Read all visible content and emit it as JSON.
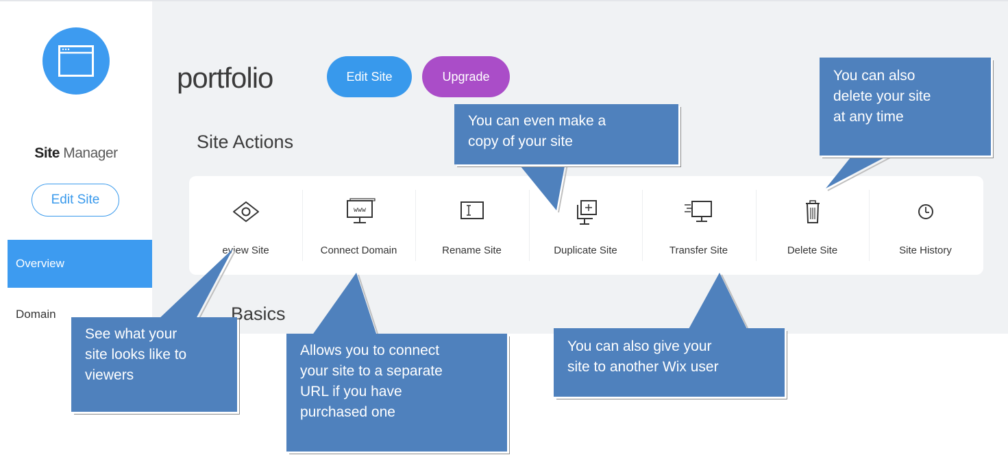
{
  "sidebar": {
    "title_bold": "Site",
    "title_rest": " Manager",
    "edit_button": "Edit Site",
    "items": [
      {
        "label": "Overview",
        "active": true
      },
      {
        "label": "Domain"
      }
    ]
  },
  "header": {
    "site_name": "portfolio",
    "edit_button": "Edit Site",
    "upgrade_button": "Upgrade"
  },
  "sections": {
    "actions_title": "Site Actions",
    "basics_title": "Basics"
  },
  "actions": [
    {
      "label": "eview Site",
      "icon": "eye-icon"
    },
    {
      "label": "Connect Domain",
      "icon": "www-monitor-icon"
    },
    {
      "label": "Rename Site",
      "icon": "rename-icon"
    },
    {
      "label": "Duplicate Site",
      "icon": "duplicate-icon"
    },
    {
      "label": "Transfer Site",
      "icon": "transfer-icon"
    },
    {
      "label": "Delete Site",
      "icon": "trash-icon"
    },
    {
      "label": "Site History",
      "icon": "clock-icon"
    }
  ],
  "callouts": {
    "preview": [
      "See what your",
      "site looks like to",
      "viewers"
    ],
    "connect": [
      "Allows you to connect",
      "your site to a separate",
      "URL if you have",
      "purchased  one"
    ],
    "duplicate": [
      "You can even make a",
      "copy of your site"
    ],
    "transfer": [
      "You can also give your",
      "site to another Wix user"
    ],
    "delete": [
      "You can also",
      "delete your site",
      "at any time"
    ]
  },
  "colors": {
    "accent_blue": "#3899ec",
    "upgrade_purple": "#aa4dc8",
    "callout_blue": "#4f81bd",
    "panel_bg": "#f0f2f4"
  }
}
